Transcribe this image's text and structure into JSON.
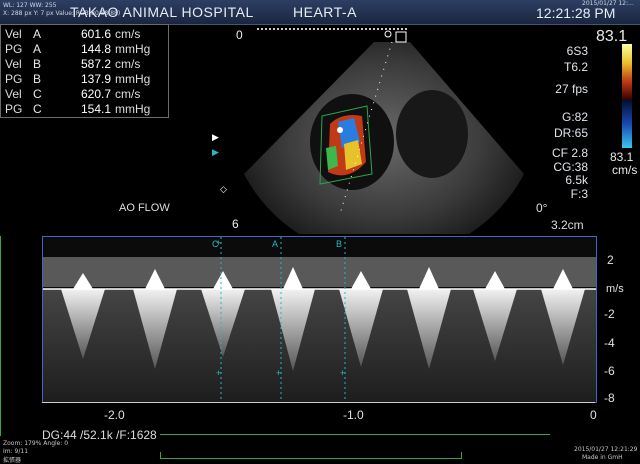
{
  "header": {
    "info_line1": "WL: 127 WW: 255",
    "info_line2": "X: 288 px Y: 7 px Value: RGB(80,88,88)",
    "hospital": "TAKAO ANIMAL HOSPITAL",
    "study": "HEART-A",
    "time": "12:21:28 PM",
    "date_small": "2015/01/27 12:..."
  },
  "measurements": [
    {
      "label": "Vel",
      "letter": "A",
      "value": "601.6",
      "unit": "cm/s"
    },
    {
      "label": "PG",
      "letter": "A",
      "value": "144.8",
      "unit": "mmHg"
    },
    {
      "label": "Vel",
      "letter": "B",
      "value": "587.2",
      "unit": "cm/s"
    },
    {
      "label": "PG",
      "letter": "B",
      "value": "137.9",
      "unit": "mmHg"
    },
    {
      "label": "Vel",
      "letter": "C",
      "value": "620.7",
      "unit": "cm/s"
    },
    {
      "label": "PG",
      "letter": "C",
      "value": "154.1",
      "unit": "mmHg"
    }
  ],
  "sector": {
    "depth_top": "0",
    "depth_bottom": "6",
    "angle": "0°",
    "depth_cm": "3.2cm",
    "label": "AO FLOW"
  },
  "params": {
    "probe": "6S3",
    "tissue": "T6.2",
    "fps": "27 fps",
    "gain": "G:82",
    "dr": "DR:65",
    "cf": "CF 2.8",
    "cg": "CG:38",
    "khz": "6.5k",
    "f": "F:3",
    "scale_top": "83.1",
    "scale_bottom": "83.1",
    "scale_unit": "cm/s"
  },
  "doppler": {
    "y_ticks": [
      "2",
      "-2",
      "-4",
      "-6",
      "-8"
    ],
    "y_unit": "m/s",
    "x_ticks": [
      "-2.0",
      "-1.0",
      "0"
    ],
    "markers": [
      "C",
      "A",
      "B"
    ],
    "status": "DG:44   /52.1k   /F:1628"
  },
  "footer": {
    "left1": "Zoom: 179% Angle: 0",
    "left2": "Im: 9/11",
    "left3": "拡張器",
    "right1": "2015/01/27 12:21:29",
    "right2": "Made in GmH"
  },
  "colors": {
    "frame_blue": "#3f66c8",
    "header_bg": "#24355a",
    "marker_cyan": "#27b8c8",
    "trace_green": "#3aa34a"
  }
}
